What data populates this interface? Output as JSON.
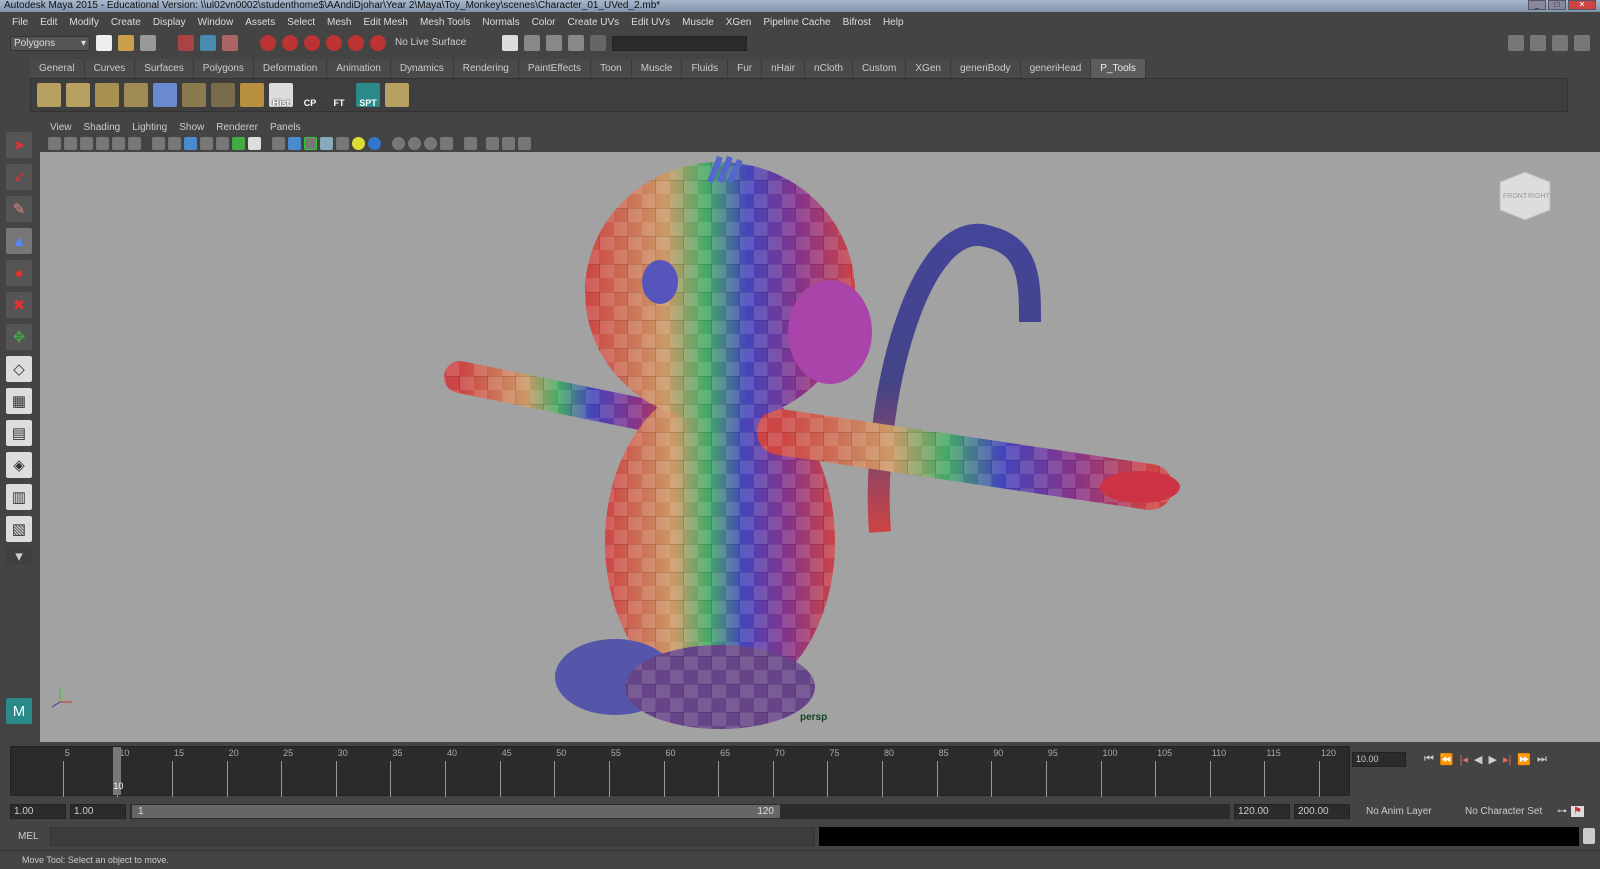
{
  "title": "Autodesk Maya 2015 - Educational Version: \\\\ul02vn0002\\studenthome$\\AAndiDjohar\\Year 2\\Maya\\Toy_Monkey\\scenes\\Character_01_UVed_2.mb*",
  "menu": [
    "File",
    "Edit",
    "Modify",
    "Create",
    "Display",
    "Window",
    "Assets",
    "Select",
    "Mesh",
    "Edit Mesh",
    "Mesh Tools",
    "Normals",
    "Color",
    "Create UVs",
    "Edit UVs",
    "Muscle",
    "XGen",
    "Pipeline Cache",
    "Bifrost",
    "Help"
  ],
  "status": {
    "mode": "Polygons",
    "live_surface": "No Live Surface"
  },
  "shelf_tabs": [
    "General",
    "Curves",
    "Surfaces",
    "Polygons",
    "Deformation",
    "Animation",
    "Dynamics",
    "Rendering",
    "PaintEffects",
    "Toon",
    "Muscle",
    "Fluids",
    "Fur",
    "nHair",
    "nCloth",
    "Custom",
    "XGen",
    "generiBody",
    "generiHead",
    "P_Tools"
  ],
  "active_shelf": "P_Tools",
  "shelf_buttons": [
    "Hist",
    "CP",
    "FT",
    "SPT"
  ],
  "viewport_menu": [
    "View",
    "Shading",
    "Lighting",
    "Show",
    "Renderer",
    "Panels"
  ],
  "viewport": {
    "camera": "persp",
    "viewcube": [
      "FRONT",
      "RIGHT"
    ]
  },
  "timeline": {
    "ticks": [
      "5",
      "10",
      "15",
      "20",
      "25",
      "30",
      "35",
      "40",
      "45",
      "50",
      "55",
      "60",
      "65",
      "70",
      "75",
      "80",
      "85",
      "90",
      "95",
      "100",
      "105",
      "110",
      "115",
      "120"
    ],
    "current_frame": "10",
    "current_time": "10.00"
  },
  "range": {
    "start_time": "1.00",
    "playback_start": "1.00",
    "slider_start": "1",
    "slider_end": "120",
    "playback_end": "120.00",
    "end_time": "200.00",
    "anim_layer": "No Anim Layer",
    "character_set": "No Character Set"
  },
  "mel": {
    "label": "MEL"
  },
  "help_line": "Move Tool: Select an object to move.",
  "colors": {
    "viewport_bg": "#a2a2a2",
    "panel": "#444444",
    "active_tab": "#5d5d5d"
  }
}
